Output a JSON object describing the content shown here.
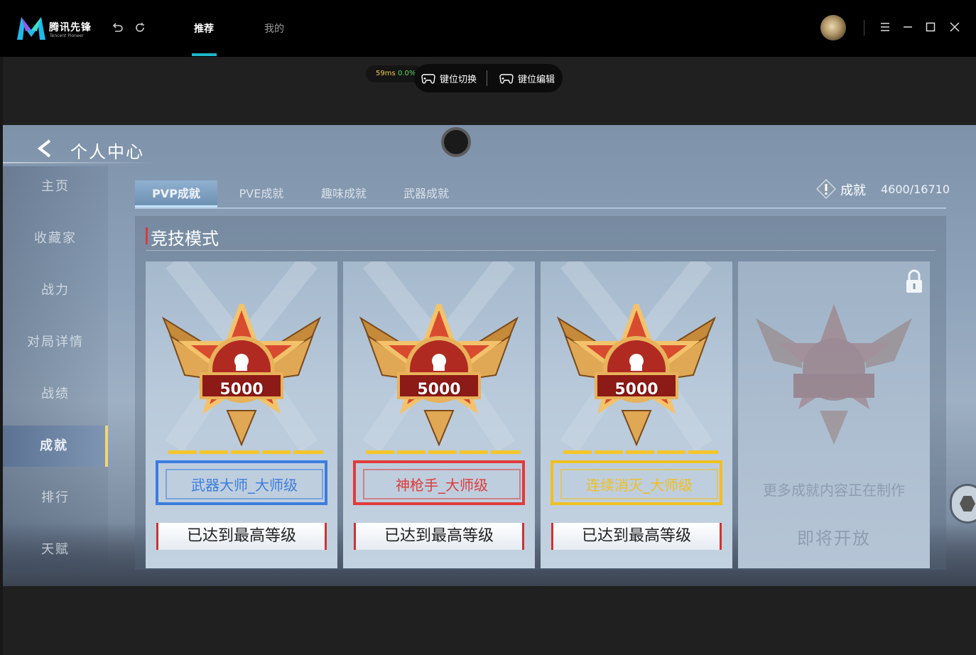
{
  "app": {
    "logo_title": "腾讯先锋",
    "logo_subtitle": "Tencent Pioneer"
  },
  "nav": {
    "recommend": "推荐",
    "mine": "我的"
  },
  "overlay": {
    "ping": "59ms",
    "loss": "0.0%",
    "key_switch": "键位切换",
    "key_edit": "键位编辑"
  },
  "game": {
    "page_title": "个人中心",
    "sidebar": [
      {
        "label": "主页"
      },
      {
        "label": "收藏家"
      },
      {
        "label": "战力"
      },
      {
        "label": "对局详情"
      },
      {
        "label": "战绩"
      },
      {
        "label": "成就",
        "active": true
      },
      {
        "label": "排行"
      },
      {
        "label": "天赋"
      }
    ],
    "tabs": [
      {
        "label": "PVP成就",
        "active": true
      },
      {
        "label": "PVE成就"
      },
      {
        "label": "趣味成就"
      },
      {
        "label": "武器成就"
      }
    ],
    "achievement_label": "成就",
    "achievement_count": "4600/16710",
    "section_title": "竞技模式",
    "cards": [
      {
        "medal_value": "5000",
        "name": "武器大师_大师级",
        "status": "已达到最高等级",
        "color": "#3b7de0"
      },
      {
        "medal_value": "5000",
        "name": "神枪手_大师级",
        "status": "已达到最高等级",
        "color": "#e03b3b"
      },
      {
        "medal_value": "5000",
        "name": "连续消灭_大师级",
        "status": "已达到最高等级",
        "color": "#f0c020"
      }
    ],
    "locked_card": {
      "message": "更多成就内容正在制作",
      "coming_soon": "即将开放",
      "icon": "lock-icon"
    }
  }
}
